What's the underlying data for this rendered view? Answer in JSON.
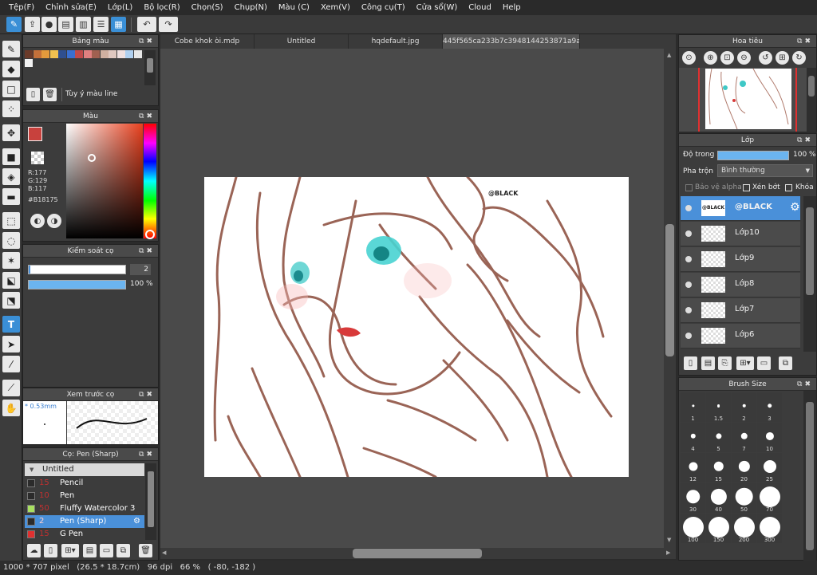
{
  "menu": [
    "Tệp(F)",
    "Chỉnh sửa(E)",
    "Lớp(L)",
    "Bộ lọc(R)",
    "Chọn(S)",
    "Chụp(N)",
    "Màu (C)",
    "Xem(V)",
    "Công cụ(T)",
    "Cửa sổ(W)",
    "Cloud",
    "Help"
  ],
  "tabs": [
    "Cobe khok òi.mdp",
    "Untitled",
    "hqdefault.jpg",
    "445f565ca233b7c3948144253871a9ad.png"
  ],
  "palette": {
    "title": "Bảng màu",
    "custom_label": "Tùy ý màu line",
    "swatches": [
      "#6b3b2a",
      "#c4703a",
      "#e39a3c",
      "#f0c050",
      "#2f4f8f",
      "#3a6fd0",
      "#c04a4a",
      "#e08080",
      "#a06050",
      "#d0b0a0",
      "#e0c8c0",
      "#f0e0e0",
      "#b0d0f0",
      "#e8e8e8"
    ]
  },
  "color": {
    "title": "Màu",
    "r": "R:177",
    "g": "G:129",
    "b": "B:117",
    "hex": "#B18175",
    "current": "#c8413d"
  },
  "brush_control": {
    "title": "Kiểm soát cọ",
    "size": "2",
    "opacity": "100 %",
    "opacity_value": 100
  },
  "brush_preview": {
    "title": "Xem trước cọ",
    "size_label": "* 0.53mm"
  },
  "brush_list": {
    "title": "Cọ: Pen (Sharp)",
    "group": "Untitled",
    "items": [
      {
        "size": "15",
        "name": "Pencil",
        "color": "#2b2b2b"
      },
      {
        "size": "10",
        "name": "Pen",
        "color": "#2b2b2b"
      },
      {
        "size": "50",
        "name": "Fluffy Watercolor 3",
        "color": "#a8e060"
      },
      {
        "size": "2",
        "name": "Pen (Sharp)",
        "color": "#2b2b2b",
        "selected": true
      },
      {
        "size": "15",
        "name": "G Pen",
        "color": "#e03030"
      }
    ]
  },
  "navigator": {
    "title": "Hoa tiêu"
  },
  "layers": {
    "title": "Lớp",
    "opacity_label": "Độ trong",
    "opacity_value": "100 %",
    "blend_label": "Pha trộn",
    "blend_value": "Bình thường",
    "protect_alpha": "Bảo vệ alpha",
    "clipping": "Xén bớt",
    "lock": "Khóa",
    "items": [
      {
        "name": "@BLACK",
        "selected": true
      },
      {
        "name": "Lớp10"
      },
      {
        "name": "Lớp9"
      },
      {
        "name": "Lớp8"
      },
      {
        "name": "Lớp7"
      },
      {
        "name": "Lớp6"
      }
    ]
  },
  "brush_size": {
    "title": "Brush Size",
    "sizes": [
      "1",
      "1.5",
      "2",
      "3",
      "4",
      "5",
      "7",
      "10",
      "12",
      "15",
      "20",
      "25",
      "30",
      "40",
      "50",
      "70",
      "100",
      "150",
      "200",
      "300"
    ]
  },
  "canvas": {
    "watermark": "@BLACK"
  },
  "status": {
    "text": "1000 * 707 pixel   (26.5 * 18.7cm)   96 dpi   66 %   ( -80, -182 )"
  }
}
